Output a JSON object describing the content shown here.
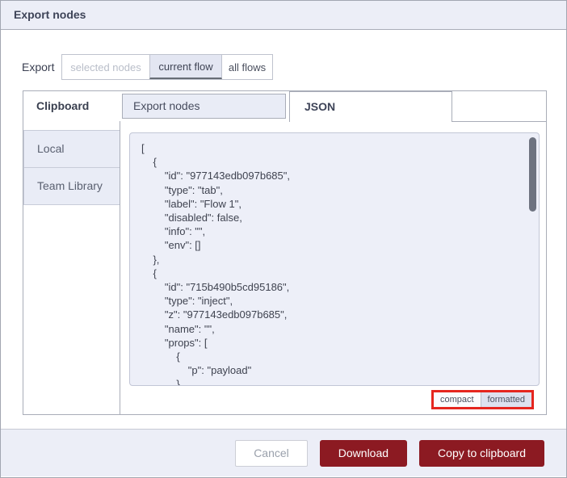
{
  "dialog": {
    "title": "Export nodes"
  },
  "export_row": {
    "label": "Export",
    "options": [
      {
        "label": "selected nodes",
        "state": "disabled"
      },
      {
        "label": "current flow",
        "state": "selected"
      },
      {
        "label": "all flows",
        "state": "normal"
      }
    ]
  },
  "tabs": {
    "clipboard": "Clipboard",
    "export_nodes": "Export nodes",
    "json": "JSON"
  },
  "sidebar": {
    "items": [
      {
        "label": "Local"
      },
      {
        "label": "Team Library"
      }
    ]
  },
  "editor": {
    "json_text": "[\n    {\n        \"id\": \"977143edb097b685\",\n        \"type\": \"tab\",\n        \"label\": \"Flow 1\",\n        \"disabled\": false,\n        \"info\": \"\",\n        \"env\": []\n    },\n    {\n        \"id\": \"715b490b5cd95186\",\n        \"type\": \"inject\",\n        \"z\": \"977143edb097b685\",\n        \"name\": \"\",\n        \"props\": [\n            {\n                \"p\": \"payload\"\n            },"
  },
  "format_toggle": {
    "compact": "compact",
    "formatted": "formatted",
    "selected": "formatted",
    "highlight_color": "#e5261f"
  },
  "footer": {
    "cancel": "Cancel",
    "download": "Download",
    "copy": "Copy to clipboard"
  },
  "colors": {
    "accent_maroon": "#8c1a22",
    "header_bg": "#eceef7",
    "panel_border": "#a9adb8",
    "inactive_tab_bg": "#e9ecf6"
  }
}
